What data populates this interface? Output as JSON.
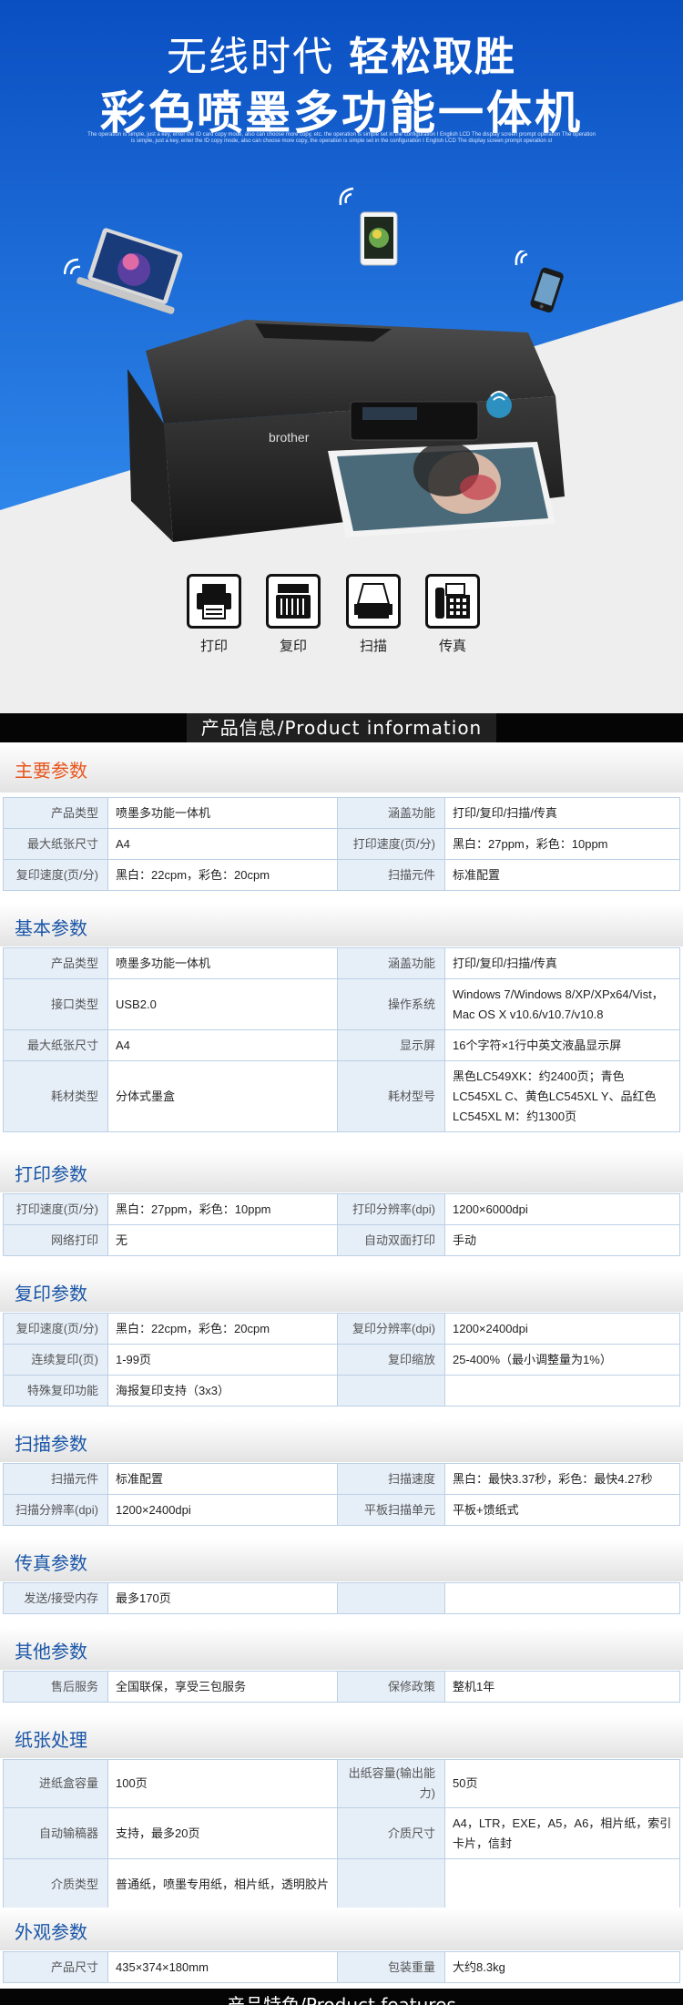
{
  "hero": {
    "title_normal": "无线时代 ",
    "title_bold": "轻松取胜",
    "subtitle": "彩色喷墨多功能一体机",
    "fine_print": "The operation is simple, just a key, enter the ID card copy mode, also can choose more copy, etc. the operation is simple set in the configuration I English LCD The display screen prompt operation The operation is simple, just a key, enter the ID copy mode, also can choose more copy, the operation is simple set in the configuration I English LCD The display screen prompt operation st",
    "printer_brand": "brother",
    "features": [
      {
        "label": "打印",
        "icon": "printer-icon"
      },
      {
        "label": "复印",
        "icon": "copier-icon"
      },
      {
        "label": "扫描",
        "icon": "scanner-icon"
      },
      {
        "label": "传真",
        "icon": "fax-icon"
      }
    ],
    "colors": {
      "blue_top": "#0a4fc2",
      "blue_bottom": "#2e86ea",
      "background": "#eeeeee"
    }
  },
  "product_info_title": "产品信息/Product information",
  "sections": [
    {
      "title": "主要参数",
      "title_color": "#e8541c",
      "rows": [
        [
          "产品类型",
          "喷墨多功能一体机",
          "涵盖功能",
          "打印/复印/扫描/传真"
        ],
        [
          "最大纸张尺寸",
          "A4",
          "打印速度(页/分)",
          "黑白：27ppm，彩色：10ppm"
        ],
        [
          "复印速度(页/分)",
          "黑白：22cpm，彩色：20cpm",
          "扫描元件",
          "标准配置"
        ]
      ]
    },
    {
      "title": "基本参数",
      "title_color": "#1a56a8",
      "rows": [
        [
          "产品类型",
          "喷墨多功能一体机",
          "涵盖功能",
          "打印/复印/扫描/传真"
        ],
        [
          "接口类型",
          "USB2.0",
          "操作系统",
          "Windows 7/Windows 8/XP/XPx64/Vist，Mac OS X v10.6/v10.7/v10.8"
        ],
        [
          "最大纸张尺寸",
          "A4",
          "显示屏",
          "16个字符×1行中英文液晶显示屏"
        ],
        [
          "耗材类型",
          "分体式墨盒",
          "耗材型号",
          "黑色LC549XK：约2400页；青色LC545XL C、黄色LC545XL Y、品红色LC545XL M：约1300页"
        ]
      ]
    },
    {
      "title": "打印参数",
      "title_color": "#1a56a8",
      "rows": [
        [
          "打印速度(页/分)",
          "黑白：27ppm，彩色：10ppm",
          "打印分辨率(dpi)",
          "1200×6000dpi"
        ],
        [
          "网络打印",
          "无",
          "自动双面打印",
          "手动"
        ]
      ]
    },
    {
      "title": "复印参数",
      "title_color": "#1a56a8",
      "rows": [
        [
          "复印速度(页/分)",
          "黑白：22cpm，彩色：20cpm",
          "复印分辨率(dpi)",
          "1200×2400dpi"
        ],
        [
          "连续复印(页)",
          "1-99页",
          "复印缩放",
          "25-400%（最小调整量为1%）"
        ],
        [
          "特殊复印功能",
          "海报复印支持（3x3）",
          "",
          ""
        ]
      ]
    },
    {
      "title": "扫描参数",
      "title_color": "#1a56a8",
      "rows": [
        [
          "扫描元件",
          "标准配置",
          "扫描速度",
          "黑白：最快3.37秒，彩色：最快4.27秒"
        ],
        [
          "扫描分辨率(dpi)",
          "1200×2400dpi",
          "平板扫描单元",
          "平板+馈纸式"
        ]
      ]
    },
    {
      "title": "传真参数",
      "title_color": "#1a56a8",
      "rows": [
        [
          "发送/接受内存",
          "最多170页",
          "",
          ""
        ]
      ]
    },
    {
      "title": "其他参数",
      "title_color": "#1a56a8",
      "rows": [
        [
          "售后服务",
          "全国联保，享受三包服务",
          "保修政策",
          "整机1年"
        ]
      ]
    },
    {
      "title": "纸张处理",
      "title_color": "#1a56a8",
      "rows": [
        [
          "进纸盒容量",
          "100页",
          "出纸容量(输出能力)",
          "50页"
        ],
        [
          "自动输稿器",
          "支持，最多20页",
          "介质尺寸",
          "A4，LTR，EXE，A5，A6，相片纸，索引卡片，信封"
        ],
        [
          "介质类型",
          "普通纸，喷墨专用纸，相片纸，透明胶片",
          "",
          ""
        ]
      ]
    },
    {
      "title": "外观参数",
      "title_color": "#1a56a8",
      "rows": [
        [
          "产品尺寸",
          "435×374×180mm",
          "包装重量",
          "大约8.3kg"
        ]
      ]
    }
  ]
}
